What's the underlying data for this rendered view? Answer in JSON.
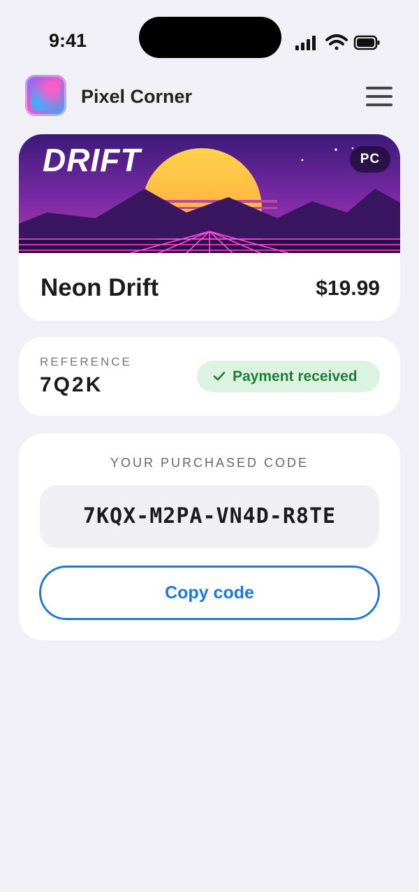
{
  "status_bar": {
    "time": "9:41",
    "icons": [
      "signal-icon",
      "wifi-icon",
      "battery-icon"
    ]
  },
  "header": {
    "app_name": "Pixel Corner",
    "logo_icon": "app-logo-icon",
    "menu_icon": "hamburger-menu-icon"
  },
  "product": {
    "banner_title": "DRIFT",
    "platform": "PC",
    "name": "Neon Drift",
    "price": "$19.99"
  },
  "order": {
    "reference_label": "REFERENCE",
    "reference": "7Q2K",
    "status": "Payment received",
    "status_icon": "checkmark-icon",
    "status_color": "#1f7d36"
  },
  "code": {
    "label": "YOUR PURCHASED CODE",
    "value": "7KQX-M2PA-VN4D-R8TE",
    "copy_label": "Copy code",
    "accent": "#1f77d6"
  }
}
